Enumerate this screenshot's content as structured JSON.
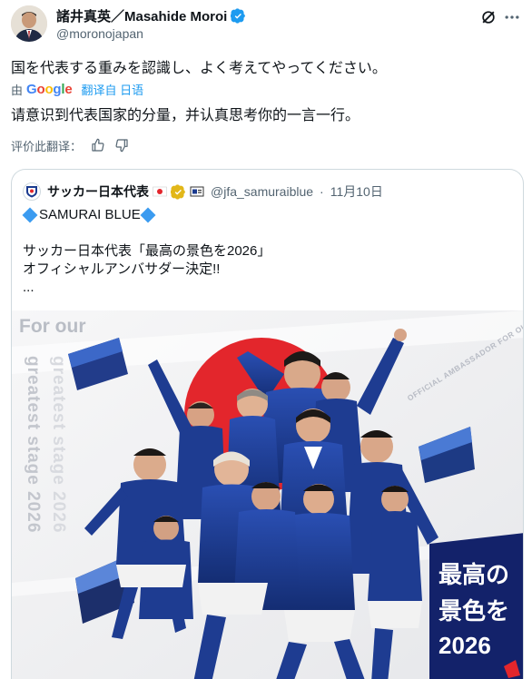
{
  "author": {
    "name": "諸井真英／Masahide Moroi",
    "handle": "@moronojapan",
    "verified": true
  },
  "tweet": {
    "text": "国を代表する重みを認識し、よく考えてやってください。",
    "translated_by_label": "由",
    "google_label": "Google",
    "translated_from_label": "翻译自 日语",
    "translated_text": "请意识到代表国家的分量，并认真思考你的一言一行。",
    "rate_translation_label": "评价此翻译："
  },
  "quote": {
    "name": "サッカー日本代表",
    "handle": "@jfa_samuraiblue",
    "date": "11月10日",
    "line1": "SAMURAI BLUE",
    "line2": "サッカー日本代表「最高の景色を2026」",
    "line3": "オフィシャルアンバサダー決定!!",
    "line4": "..."
  },
  "poster": {
    "left_text_1": "For our",
    "left_text_2": "greatest stage 2026",
    "right_text": "OFFICIAL AMBASSADOR FOR OUR GREATEST STAGE",
    "banner_line1": "最高の",
    "banner_line2": "景色を",
    "banner_line3": "2026"
  },
  "colors": {
    "accent": "#1d9bf0",
    "jersey": "#1a3a8f",
    "sun": "#e3262c"
  }
}
